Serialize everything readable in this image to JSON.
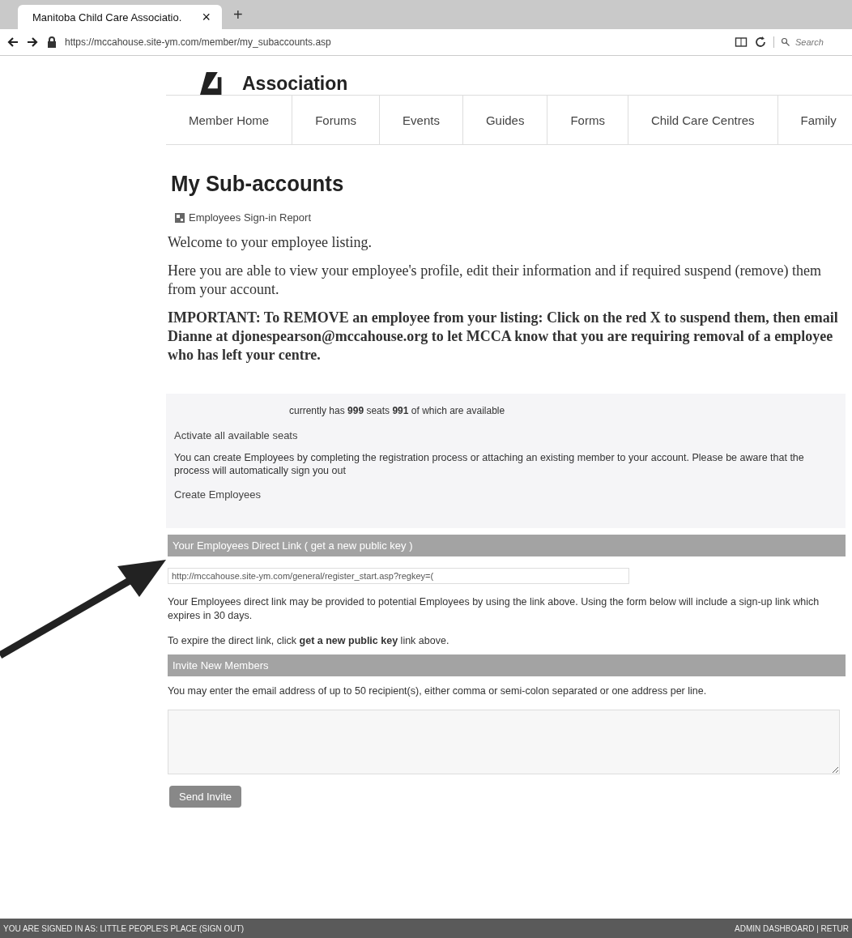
{
  "browser": {
    "tab_title": "Manitoba Child Care Associatio.",
    "tab_close": "×",
    "new_tab": "+",
    "url": "https://mccahouse.site-ym.com/member/my_subaccounts.asp",
    "search_placeholder": "Search"
  },
  "logo": {
    "text": "Association"
  },
  "nav": [
    {
      "label": "Member Home",
      "selected": false
    },
    {
      "label": "Forums",
      "selected": false
    },
    {
      "label": "Events",
      "selected": false
    },
    {
      "label": "Guides",
      "selected": false
    },
    {
      "label": "Forms",
      "selected": false
    },
    {
      "label": "Child Care Centres",
      "selected": false
    },
    {
      "label": "Family",
      "selected": false
    }
  ],
  "page_title": "My Sub-accounts",
  "report_link": "Employees Sign-in Report",
  "welcome": "Welcome to your employee listing.",
  "intro": "Here you are able to view your employee's profile, edit their information and if required suspend (remove) them from your account.",
  "important": "IMPORTANT:  To REMOVE an employee from your listing:  Click on the red X to suspend them, then email Dianne at djonespearson@mccahouse.org to let MCCA know that you are requiring removal of a employee who has left your centre.",
  "seats_panel": {
    "summary": "currently has **999** seats  **991** of which are available",
    "activate_link": "Activate all available seats",
    "info": "You can create Employees by completing the registration process or attaching an existing member to your account. Please be aware that the process will automatically sign you out",
    "create_link": "Create Employees"
  },
  "direct_link": {
    "header": "Your Employees Direct Link ( get a new public key )",
    "url_value": "http://mccahouse.site-ym.com/general/register_start.asp?regkey=(",
    "note": "Your Employees direct link may be provided to potential Employees by using the link above. Using the form below will include a sign-up link which expires in 30 days.",
    "expire_note": "To expire the direct link, click **get a new public key** link above."
  },
  "invite": {
    "header": "Invite New Members",
    "instructions": "You may enter the email address of up to 50 recipient(s), either comma or semi-colon separated or one address per line.",
    "button": "Send Invite"
  },
  "footer": {
    "signed_in": "YOU ARE SIGNED IN AS: LITTLE PEOPLE'S PLACE (SIGN OUT)",
    "right": "ADMIN DASHBOARD | RETUR"
  }
}
